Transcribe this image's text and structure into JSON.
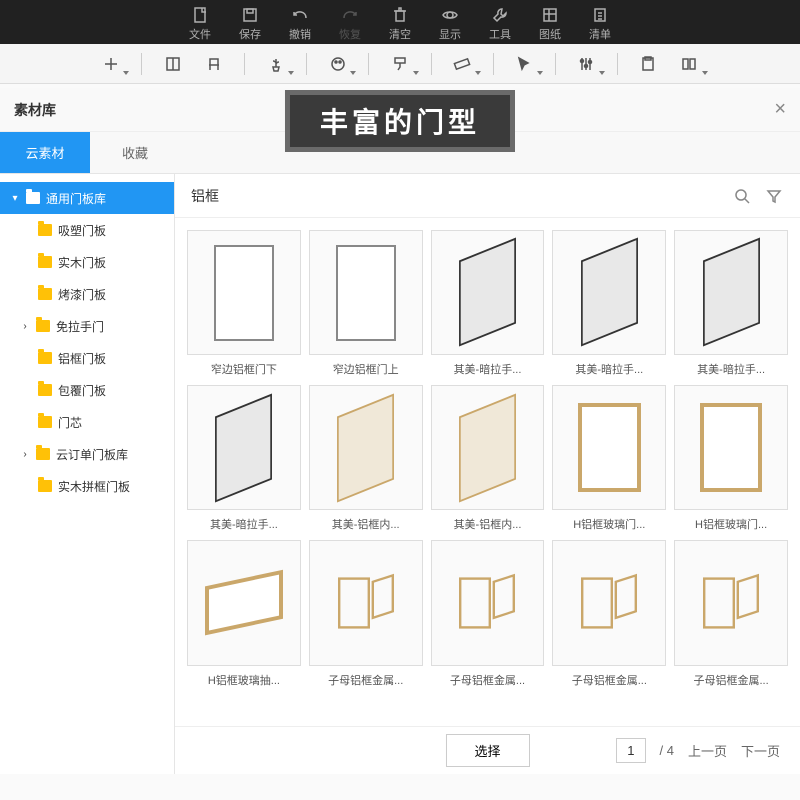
{
  "top_menu": [
    {
      "label": "文件",
      "icon": "file"
    },
    {
      "label": "保存",
      "icon": "save"
    },
    {
      "label": "撤销",
      "icon": "undo"
    },
    {
      "label": "恢复",
      "icon": "redo",
      "disabled": true
    },
    {
      "label": "清空",
      "icon": "clear"
    },
    {
      "label": "显示",
      "icon": "display"
    },
    {
      "label": "工具",
      "icon": "tool"
    },
    {
      "label": "图纸",
      "icon": "drawing"
    },
    {
      "label": "清单",
      "icon": "list"
    }
  ],
  "banner_text": "丰富的门型",
  "panel": {
    "title": "素材库",
    "close": "×"
  },
  "tabs": [
    {
      "label": "云素材",
      "active": true
    },
    {
      "label": "收藏",
      "active": false
    }
  ],
  "tree": [
    {
      "label": "通用门板库",
      "level": 0,
      "chev": "▾",
      "selected": true
    },
    {
      "label": "吸塑门板",
      "level": 1
    },
    {
      "label": "实木门板",
      "level": 1
    },
    {
      "label": "烤漆门板",
      "level": 1
    },
    {
      "label": "免拉手门",
      "level": 1,
      "chev": "›"
    },
    {
      "label": "铝框门板",
      "level": 1
    },
    {
      "label": "包覆门板",
      "level": 1
    },
    {
      "label": "门芯",
      "level": 1
    },
    {
      "label": "云订单门板库",
      "level": 1,
      "chev": "›"
    },
    {
      "label": "实木拼框门板",
      "level": 1
    }
  ],
  "search": {
    "text": "铝框"
  },
  "grid_items": [
    {
      "label": "窄边铝框门下",
      "thumb": "flat"
    },
    {
      "label": "窄边铝框门上",
      "thumb": "flat"
    },
    {
      "label": "其美-暗拉手...",
      "thumb": "iso"
    },
    {
      "label": "其美-暗拉手...",
      "thumb": "iso"
    },
    {
      "label": "其美-暗拉手...",
      "thumb": "iso"
    },
    {
      "label": "其美-暗拉手...",
      "thumb": "iso"
    },
    {
      "label": "其美-铝框内...",
      "thumb": "isolt"
    },
    {
      "label": "其美-铝框内...",
      "thumb": "isolt"
    },
    {
      "label": "H铝框玻璃门...",
      "thumb": "h"
    },
    {
      "label": "H铝框玻璃门...",
      "thumb": "h"
    },
    {
      "label": "H铝框玻璃抽...",
      "thumb": "hz"
    },
    {
      "label": "子母铝框金属...",
      "thumb": "pair"
    },
    {
      "label": "子母铝框金属...",
      "thumb": "pair"
    },
    {
      "label": "子母铝框金属...",
      "thumb": "pair"
    },
    {
      "label": "子母铝框金属...",
      "thumb": "pair"
    }
  ],
  "pagination": {
    "current": "1",
    "total": "/ 4",
    "prev": "上一页",
    "next": "下一页"
  },
  "select_button": "选择"
}
